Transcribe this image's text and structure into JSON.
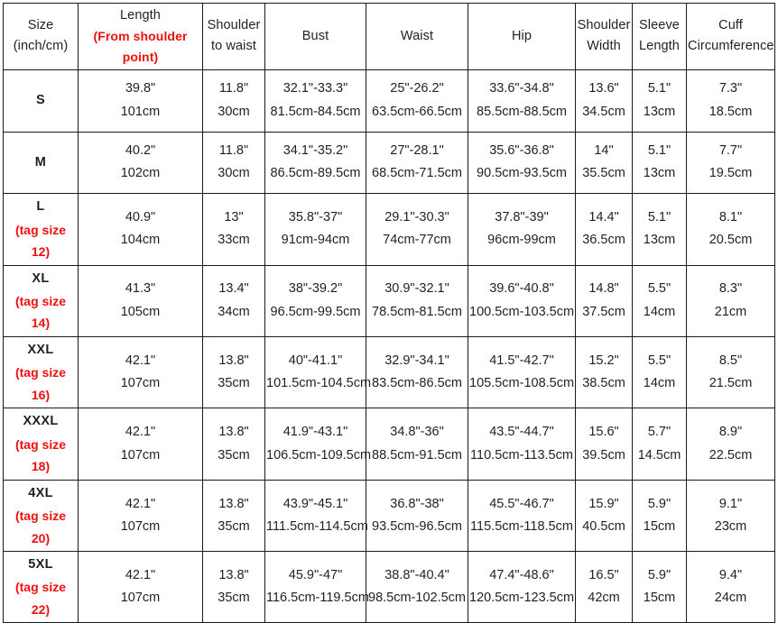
{
  "table": {
    "name": "size-chart",
    "accent_red": "#f00f0f",
    "text_color": "#231f20",
    "border_color": "#1a1a1a",
    "headers": {
      "size": {
        "line1": "Size",
        "line2": "(inch/cm)"
      },
      "length": {
        "line1": "Length",
        "line2": "(From shoulder point)",
        "line2_red": true
      },
      "shoulder_to_waist": {
        "line1": "Shoulder",
        "line2": "to waist"
      },
      "bust": {
        "line1": "Bust"
      },
      "waist": {
        "line1": "Waist"
      },
      "hip": {
        "line1": "Hip"
      },
      "shoulder_width": {
        "line1": "Shoulder",
        "line2": "Width"
      },
      "sleeve_length": {
        "line1": "Sleeve",
        "line2": "Length"
      },
      "cuff_circumference": {
        "line1": "Cuff",
        "line2": "Circumference"
      }
    },
    "rows": [
      {
        "size": "S",
        "tag": "",
        "length_in": "39.8\"",
        "length_cm": "101cm",
        "stw_in": "11.8\"",
        "stw_cm": "30cm",
        "bust_in": "32.1\"-33.3\"",
        "bust_cm": "81.5cm-84.5cm",
        "waist_in": "25\"-26.2\"",
        "waist_cm": "63.5cm-66.5cm",
        "hip_in": "33.6\"-34.8\"",
        "hip_cm": "85.5cm-88.5cm",
        "shw_in": "13.6\"",
        "shw_cm": "34.5cm",
        "slv_in": "5.1\"",
        "slv_cm": "13cm",
        "cuff_in": "7.3\"",
        "cuff_cm": "18.5cm"
      },
      {
        "size": "M",
        "tag": "",
        "length_in": "40.2\"",
        "length_cm": "102cm",
        "stw_in": "11.8\"",
        "stw_cm": "30cm",
        "bust_in": "34.1\"-35.2\"",
        "bust_cm": "86.5cm-89.5cm",
        "waist_in": "27\"-28.1\"",
        "waist_cm": "68.5cm-71.5cm",
        "hip_in": "35.6\"-36.8\"",
        "hip_cm": "90.5cm-93.5cm",
        "shw_in": "14\"",
        "shw_cm": "35.5cm",
        "slv_in": "5.1\"",
        "slv_cm": "13cm",
        "cuff_in": "7.7\"",
        "cuff_cm": "19.5cm"
      },
      {
        "size": "L",
        "tag": "(tag size 12)",
        "length_in": "40.9\"",
        "length_cm": "104cm",
        "stw_in": "13\"",
        "stw_cm": "33cm",
        "bust_in": "35.8\"-37\"",
        "bust_cm": "91cm-94cm",
        "waist_in": "29.1\"-30.3\"",
        "waist_cm": "74cm-77cm",
        "hip_in": "37.8\"-39\"",
        "hip_cm": "96cm-99cm",
        "shw_in": "14.4\"",
        "shw_cm": "36.5cm",
        "slv_in": "5.1\"",
        "slv_cm": "13cm",
        "cuff_in": "8.1\"",
        "cuff_cm": "20.5cm"
      },
      {
        "size": "XL",
        "tag": "(tag size 14)",
        "length_in": "41.3\"",
        "length_cm": "105cm",
        "stw_in": "13.4\"",
        "stw_cm": "34cm",
        "bust_in": "38\"-39.2\"",
        "bust_cm": "96.5cm-99.5cm",
        "waist_in": "30.9\"-32.1\"",
        "waist_cm": "78.5cm-81.5cm",
        "hip_in": "39.6\"-40.8\"",
        "hip_cm": "100.5cm-103.5cm",
        "shw_in": "14.8\"",
        "shw_cm": "37.5cm",
        "slv_in": "5.5\"",
        "slv_cm": "14cm",
        "cuff_in": "8.3\"",
        "cuff_cm": "21cm"
      },
      {
        "size": "XXL",
        "tag": "(tag size 16)",
        "length_in": "42.1\"",
        "length_cm": "107cm",
        "stw_in": "13.8\"",
        "stw_cm": "35cm",
        "bust_in": "40\"-41.1\"",
        "bust_cm": "101.5cm-104.5cm",
        "waist_in": "32.9\"-34.1\"",
        "waist_cm": "83.5cm-86.5cm",
        "hip_in": "41.5\"-42.7\"",
        "hip_cm": "105.5cm-108.5cm",
        "shw_in": "15.2\"",
        "shw_cm": "38.5cm",
        "slv_in": "5.5\"",
        "slv_cm": "14cm",
        "cuff_in": "8.5\"",
        "cuff_cm": "21.5cm"
      },
      {
        "size": "XXXL",
        "tag": "(tag size 18)",
        "length_in": "42.1\"",
        "length_cm": "107cm",
        "stw_in": "13.8\"",
        "stw_cm": "35cm",
        "bust_in": "41.9\"-43.1\"",
        "bust_cm": "106.5cm-109.5cm",
        "waist_in": "34.8\"-36\"",
        "waist_cm": "88.5cm-91.5cm",
        "hip_in": "43.5\"-44.7\"",
        "hip_cm": "110.5cm-113.5cm",
        "shw_in": "15.6\"",
        "shw_cm": "39.5cm",
        "slv_in": "5.7\"",
        "slv_cm": "14.5cm",
        "cuff_in": "8.9\"",
        "cuff_cm": "22.5cm"
      },
      {
        "size": "4XL",
        "tag": "(tag size 20)",
        "length_in": "42.1\"",
        "length_cm": "107cm",
        "stw_in": "13.8\"",
        "stw_cm": "35cm",
        "bust_in": "43.9\"-45.1\"",
        "bust_cm": "111.5cm-114.5cm",
        "waist_in": "36.8\"-38\"",
        "waist_cm": "93.5cm-96.5cm",
        "hip_in": "45.5\"-46.7\"",
        "hip_cm": "115.5cm-118.5cm",
        "shw_in": "15.9\"",
        "shw_cm": "40.5cm",
        "slv_in": "5.9\"",
        "slv_cm": "15cm",
        "cuff_in": "9.1\"",
        "cuff_cm": "23cm"
      },
      {
        "size": "5XL",
        "tag": "(tag size 22)",
        "length_in": "42.1\"",
        "length_cm": "107cm",
        "stw_in": "13.8\"",
        "stw_cm": "35cm",
        "bust_in": "45.9\"-47\"",
        "bust_cm": "116.5cm-119.5cm",
        "waist_in": "38.8\"-40.4\"",
        "waist_cm": "98.5cm-102.5cm",
        "hip_in": "47.4\"-48.6\"",
        "hip_cm": "120.5cm-123.5cm",
        "shw_in": "16.5\"",
        "shw_cm": "42cm",
        "slv_in": "5.9\"",
        "slv_cm": "15cm",
        "cuff_in": "9.4\"",
        "cuff_cm": "24cm"
      }
    ]
  }
}
